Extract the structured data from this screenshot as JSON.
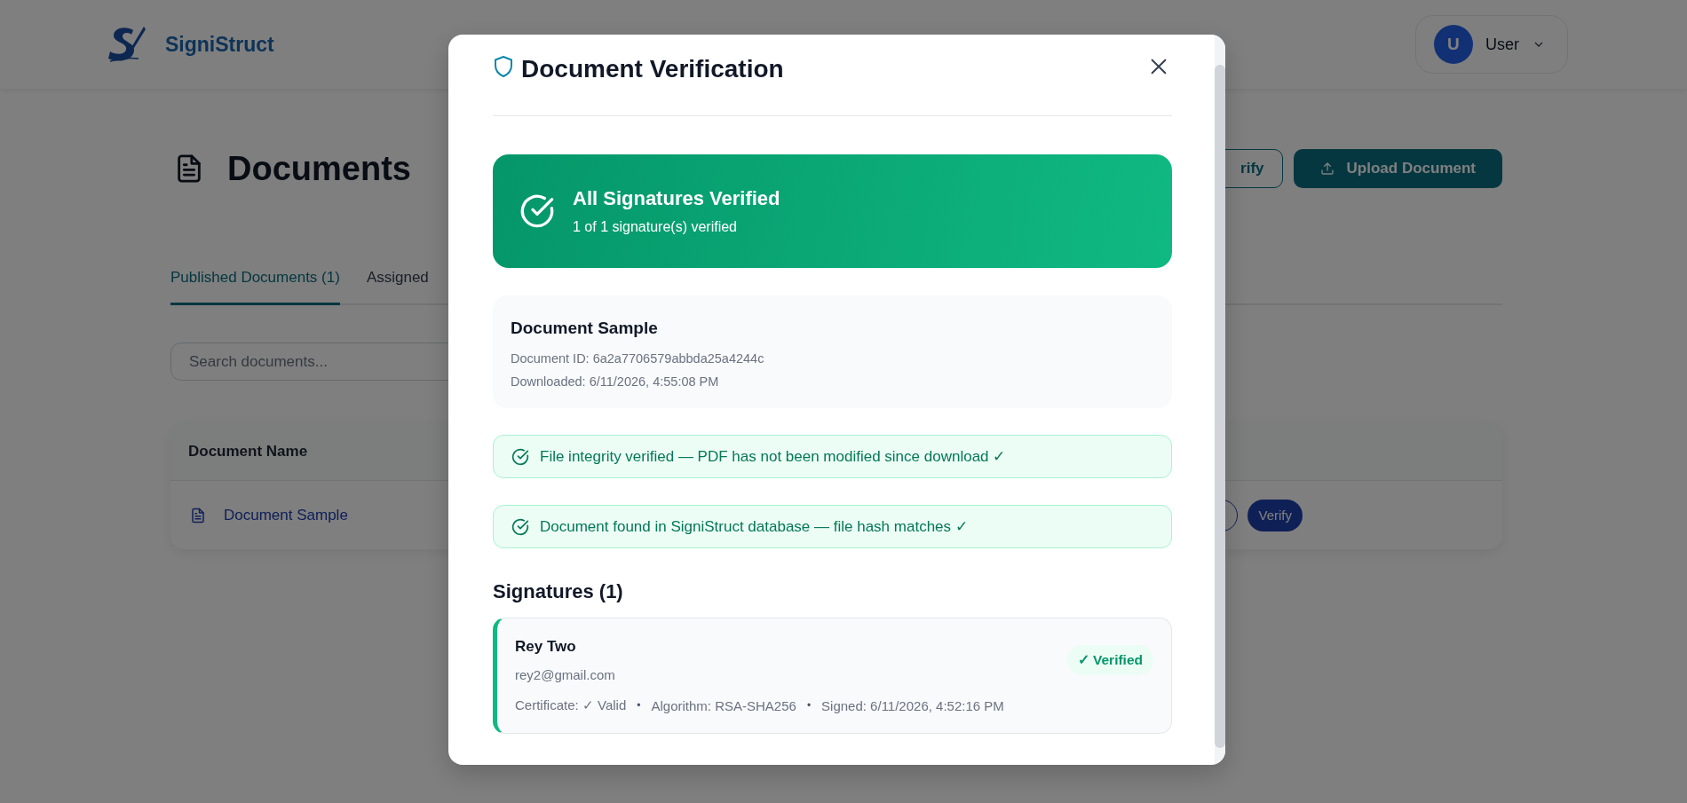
{
  "header": {
    "brand": "SigniStruct",
    "user": {
      "initial": "U",
      "name": "User"
    }
  },
  "page": {
    "title": "Documents",
    "actions": [
      {
        "label": "rify",
        "kind": "outline"
      },
      {
        "label": "Upload Document",
        "kind": "primary"
      }
    ],
    "tabs": [
      {
        "label": "Published Documents (1)",
        "selected": true
      },
      {
        "label": "Assigned",
        "selected": false
      }
    ],
    "search": {
      "placeholder": "Search documents..."
    },
    "table": {
      "columns": [
        "Document Name"
      ],
      "rows": [
        {
          "name": "Document Sample",
          "actions": [
            {
              "kind": "outline"
            },
            {
              "kind": "filled",
              "label": "Verify"
            }
          ]
        }
      ]
    }
  },
  "modal": {
    "title": "Document Verification",
    "banner": {
      "success": true,
      "title": "All Signatures Verified",
      "subtitle": "1 of 1 signature(s) verified"
    },
    "document": {
      "name": "Document Sample",
      "lines": [
        "Document ID: 6a2a7706579abbda25a4244c",
        "Downloaded: 6/11/2026, 4:55:08 PM"
      ]
    },
    "checks": [
      {
        "text": "File integrity verified — PDF has not been modified since download ✓",
        "passed": true
      },
      {
        "text": "Document found in SigniStruct database — file hash matches ✓",
        "passed": true
      }
    ],
    "signatures_heading": "Signatures (1)",
    "signatures": [
      {
        "name": "Rey Two",
        "email": "rey2@gmail.com",
        "status": "✓ Verified",
        "verified": true,
        "meta": [
          {
            "kind": "field",
            "text": "Certificate: ✓ Valid"
          },
          {
            "kind": "separator",
            "text": "•"
          },
          {
            "kind": "field",
            "text": "Algorithm: RSA-SHA256"
          },
          {
            "kind": "separator",
            "text": "•"
          },
          {
            "kind": "field",
            "text": "Signed: 6/11/2026, 4:52:16 PM"
          }
        ]
      }
    ]
  }
}
